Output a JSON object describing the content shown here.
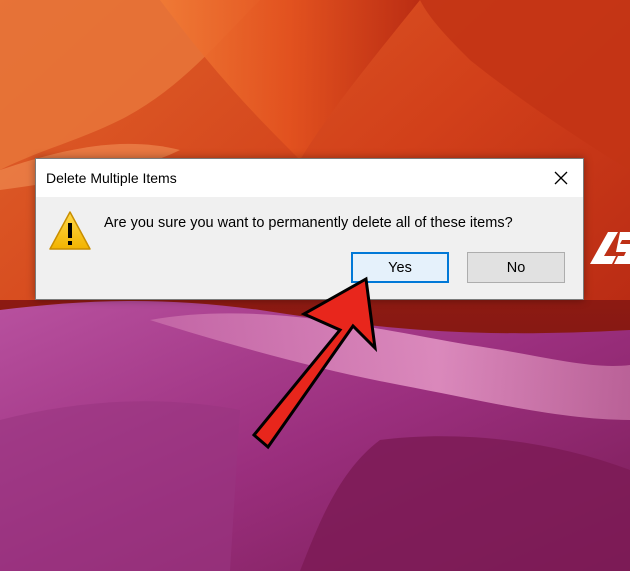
{
  "background": {
    "description_icon": "canyon-wallpaper",
    "colors": {
      "orange": "#e2581c",
      "red": "#b3200f",
      "magenta": "#a23c8a",
      "pink": "#d86fb8"
    }
  },
  "dialog": {
    "title": "Delete Multiple Items",
    "close_icon": "close-icon",
    "warning_icon": "warning-icon",
    "message": "Are you sure you want to permanently delete all of these items?",
    "buttons": {
      "yes": "Yes",
      "no": "No"
    },
    "accent_color": "#0078d7"
  },
  "annotation": {
    "arrow_icon": "red-arrow-icon",
    "arrow_color": "#e8261c"
  },
  "brand_icon": "asus-logo-fragment"
}
